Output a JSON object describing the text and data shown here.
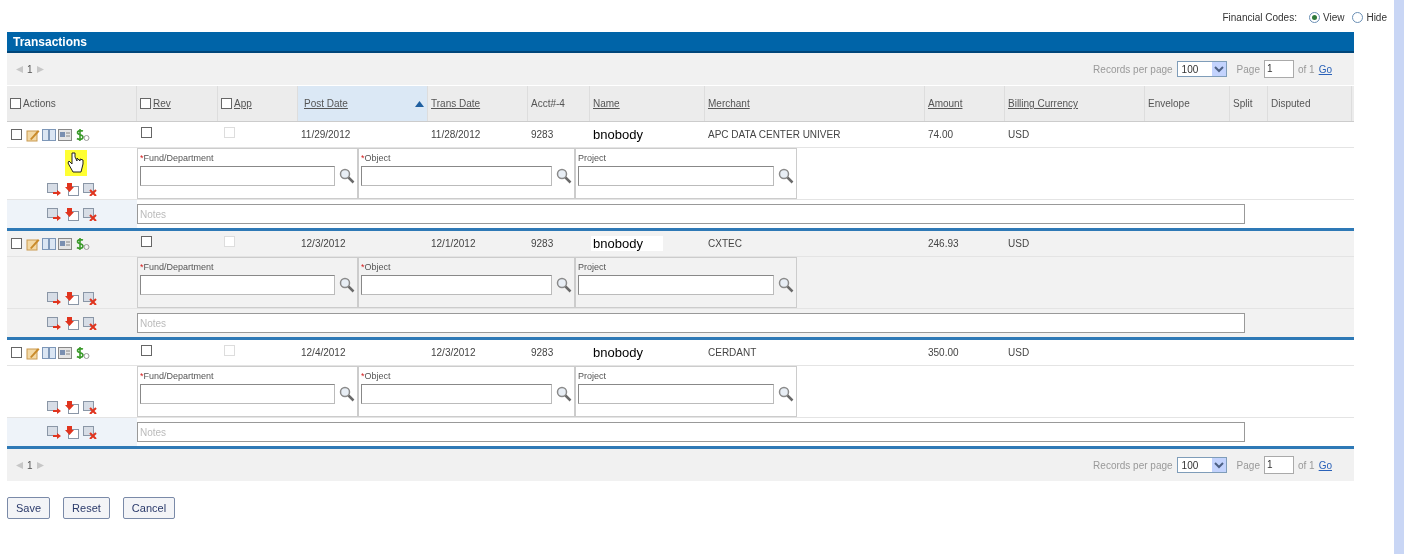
{
  "financial_codes": {
    "label": "Financial Codes:",
    "options": [
      {
        "label": "View",
        "selected": true
      },
      {
        "label": "Hide",
        "selected": false
      }
    ]
  },
  "panel": {
    "title": "Transactions"
  },
  "pager_top": {
    "page": "1",
    "records_label": "Records per page",
    "records_value": "100",
    "page_label": "Page",
    "page_value": "1",
    "of": "of 1",
    "go": "Go"
  },
  "columns": [
    {
      "label": "Actions",
      "kind": "checkbox",
      "checked": false,
      "sorted": false
    },
    {
      "label": "Rev",
      "kind": "checkbox_link",
      "checked": false,
      "sorted": false
    },
    {
      "label": "App",
      "kind": "checkbox_link",
      "checked": false,
      "sorted": false
    },
    {
      "label": "Post Date",
      "kind": "link",
      "sorted": true
    },
    {
      "label": "Trans Date",
      "kind": "link",
      "sorted": false
    },
    {
      "label": "Acct#-4",
      "kind": "plain",
      "sorted": false
    },
    {
      "label": "Name",
      "kind": "link",
      "sorted": false
    },
    {
      "label": "Merchant",
      "kind": "link",
      "sorted": false
    },
    {
      "label": "Amount",
      "kind": "link",
      "sorted": false
    },
    {
      "label": "Billing Currency",
      "kind": "link",
      "sorted": false
    },
    {
      "label": "Envelope",
      "kind": "plain",
      "sorted": false
    },
    {
      "label": "Split",
      "kind": "plain",
      "sorted": false
    },
    {
      "label": "Disputed",
      "kind": "plain",
      "sorted": false
    }
  ],
  "rows": [
    {
      "checked": false,
      "rev": false,
      "app": false,
      "post_date": "11/29/2012",
      "trans_date": "11/28/2012",
      "acct": "9283",
      "name": "bnobody",
      "merchant": "APC DATA CENTER UNIVER",
      "amount": "74.00",
      "currency": "USD",
      "fields": [
        {
          "required_mark": "*",
          "label": "Fund/Department"
        },
        {
          "required_mark": "*",
          "label": "Object"
        },
        {
          "label": "Project"
        }
      ],
      "notes_placeholder": "Notes"
    },
    {
      "checked": false,
      "rev": false,
      "app": false,
      "post_date": "12/3/2012",
      "trans_date": "12/1/2012",
      "acct": "9283",
      "name": "bnobody",
      "merchant": "CXTEC",
      "amount": "246.93",
      "currency": "USD",
      "fields": [
        {
          "required_mark": "*",
          "label": "Fund/Department"
        },
        {
          "required_mark": "*",
          "label": "Object"
        },
        {
          "label": "Project"
        }
      ],
      "notes_placeholder": "Notes"
    },
    {
      "checked": false,
      "rev": false,
      "app": false,
      "post_date": "12/4/2012",
      "trans_date": "12/3/2012",
      "acct": "9283",
      "name": "bnobody",
      "merchant": "CERDANT",
      "amount": "350.00",
      "currency": "USD",
      "fields": [
        {
          "required_mark": "*",
          "label": "Fund/Department"
        },
        {
          "required_mark": "*",
          "label": "Object"
        },
        {
          "label": "Project"
        }
      ],
      "notes_placeholder": "Notes"
    }
  ],
  "pager_bottom": {
    "page": "1",
    "records_label": "Records per page",
    "records_value": "100",
    "page_label": "Page",
    "page_value": "1",
    "of": "of 1",
    "go": "Go"
  },
  "buttons": [
    "Save",
    "Reset",
    "Cancel"
  ]
}
